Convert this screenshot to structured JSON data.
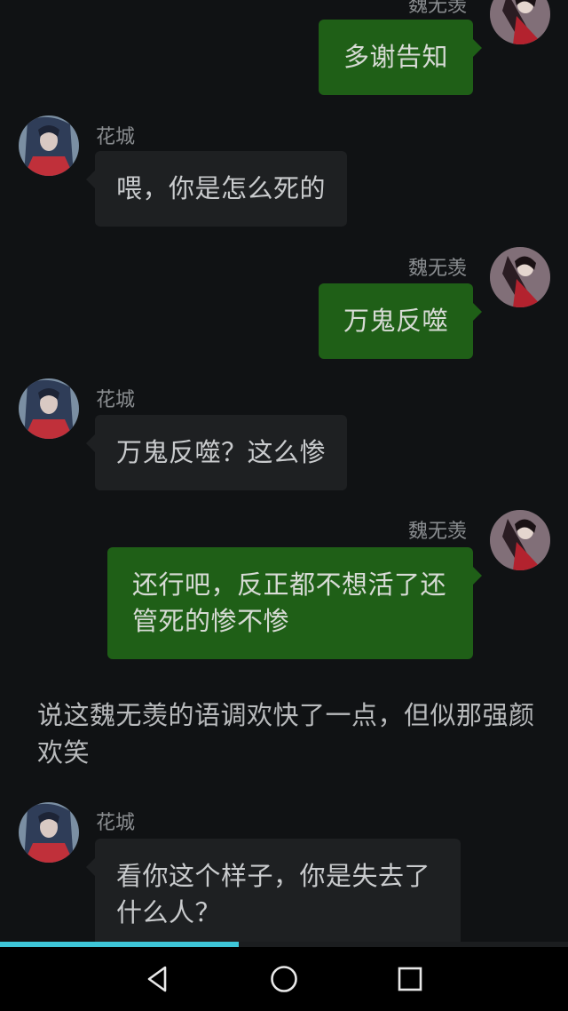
{
  "conversation": {
    "messages": [
      {
        "sender": "魏无羡",
        "side": "right",
        "text": "多谢告知"
      },
      {
        "sender": "花城",
        "side": "left",
        "text": "喂，你是怎么死的"
      },
      {
        "sender": "魏无羡",
        "side": "right",
        "text": "万鬼反噬"
      },
      {
        "sender": "花城",
        "side": "left",
        "text": "万鬼反噬？这么惨"
      },
      {
        "sender": "魏无羡",
        "side": "right",
        "text": "还行吧，反正都不想活了还管死的惨不惨"
      },
      {
        "sender": "花城",
        "side": "left",
        "text": "看你这个样子，你是失去了什么人？"
      }
    ],
    "narration": "说这魏无羡的语调欢快了一点，但似那强颜欢笑"
  },
  "progress": {
    "fraction": 0.42,
    "color": "#3ec6d8"
  },
  "colors": {
    "background": "#101214",
    "incoming_bubble": "#1e2022",
    "outgoing_bubble": "#1f5f17",
    "name_text": "#8a8d90"
  },
  "navbar": {
    "buttons": [
      {
        "name": "back",
        "icon": "triangle-back-icon"
      },
      {
        "name": "home",
        "icon": "circle-home-icon"
      },
      {
        "name": "recents",
        "icon": "square-recents-icon"
      }
    ]
  }
}
